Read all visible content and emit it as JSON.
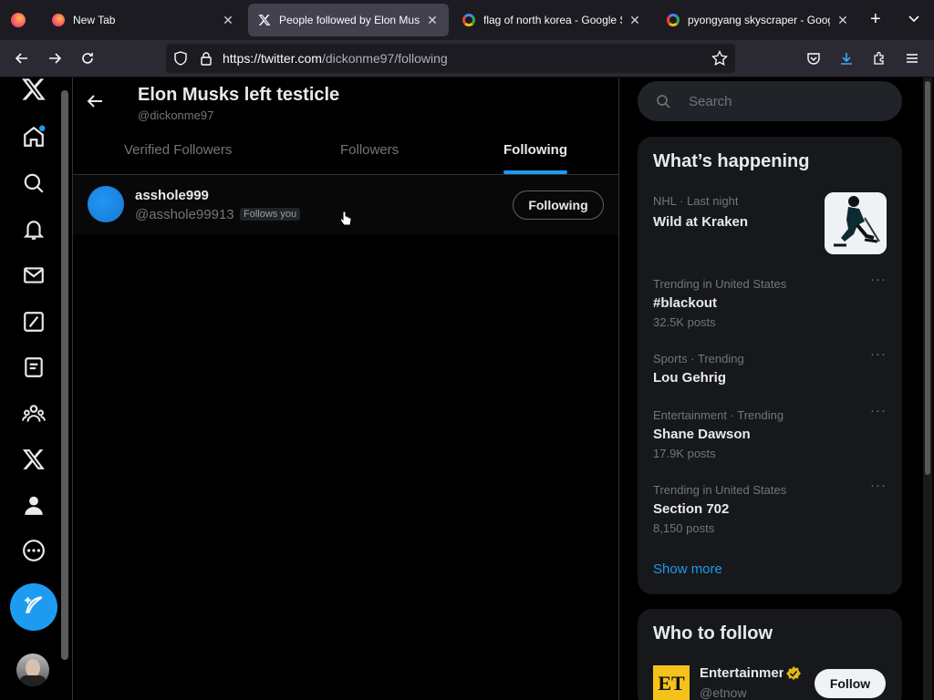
{
  "browser": {
    "tabs": [
      {
        "title": "New Tab",
        "icon": "firefox-icon",
        "active": false
      },
      {
        "title": "People followed by Elon Musks left testicle",
        "icon": "x-logo-icon",
        "active": true
      },
      {
        "title": "flag of north korea - Google Search",
        "icon": "google-icon",
        "active": false
      },
      {
        "title": "pyongyang skyscraper - Google Search",
        "icon": "google-icon",
        "active": false
      }
    ],
    "url_host": "https://twitter.com",
    "url_path": "/dickonme97/following"
  },
  "profile": {
    "display_name": "Elon Musks left testicle",
    "handle": "@dickonme97"
  },
  "tabs": {
    "verified": "Verified Followers",
    "followers": "Followers",
    "following": "Following"
  },
  "list": [
    {
      "name": "asshole999",
      "handle": "@asshole99913",
      "badge": "Follows you",
      "button": "Following"
    }
  ],
  "search": {
    "placeholder": "Search"
  },
  "happening": {
    "title": "What’s happening",
    "items": [
      {
        "meta": "NHL · Last night",
        "name": "Wild at Kraken",
        "count": ""
      },
      {
        "meta": "Trending in United States",
        "name": "#blackout",
        "count": "32.5K posts"
      },
      {
        "meta": "Sports · Trending",
        "name": "Lou Gehrig",
        "count": ""
      },
      {
        "meta": "Entertainment · Trending",
        "name": "Shane Dawson",
        "count": "17.9K posts"
      },
      {
        "meta": "Trending in United States",
        "name": "Section 702",
        "count": "8,150 posts"
      }
    ],
    "show_more": "Show more"
  },
  "who_to_follow": {
    "title": "Who to follow",
    "items": [
      {
        "name": "Entertainment Tonight",
        "handle": "@etnow",
        "logo": "ET",
        "button": "Follow"
      }
    ]
  },
  "colors": {
    "accent": "#1d9bf0",
    "background": "#000000",
    "muted": "#71767b"
  }
}
